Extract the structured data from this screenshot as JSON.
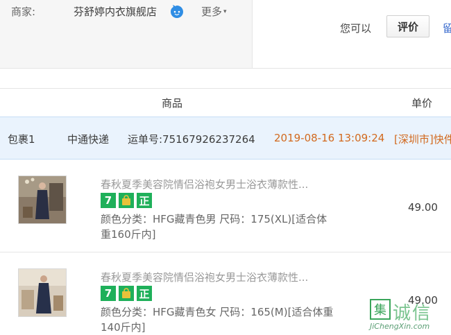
{
  "merchant": {
    "label": "商家:",
    "shop_name": "芬舒婷内衣旗舰店",
    "more": "更多",
    "more_caret": "▾"
  },
  "actions": {
    "you_can": "您可以",
    "rate_button": "评价",
    "cut_link": "留"
  },
  "columns": {
    "product": "商品",
    "price": "单价"
  },
  "package": {
    "name": "包裹1",
    "carrier": "中通快递",
    "tracking": "运单号:75167926237264",
    "time": "2019-08-16 13:09:24",
    "status": "[深圳市]快件"
  },
  "items": [
    {
      "title": "春秋夏季美容院情侣浴袍女男士浴衣薄款性...",
      "spec": "颜色分类：HFG藏青色男  尺码：175(XL)[适合体重160斤内]",
      "price": "49.00"
    },
    {
      "title": "春秋夏季美容院情侣浴袍女男士浴衣薄款性...",
      "spec": "颜色分类：HFG藏青色女  尺码：165(M)[适合体重140斤内]",
      "price": "49.00"
    }
  ],
  "badges": {
    "seven": "7",
    "zheng": "正"
  },
  "watermark": {
    "chars": "诚信",
    "box": "集",
    "url": "JiChengXin.com"
  },
  "colors": {
    "accent_orange": "#d2691e",
    "package_bar": "#eaf3fd",
    "badge_green": "#1fb05a"
  }
}
